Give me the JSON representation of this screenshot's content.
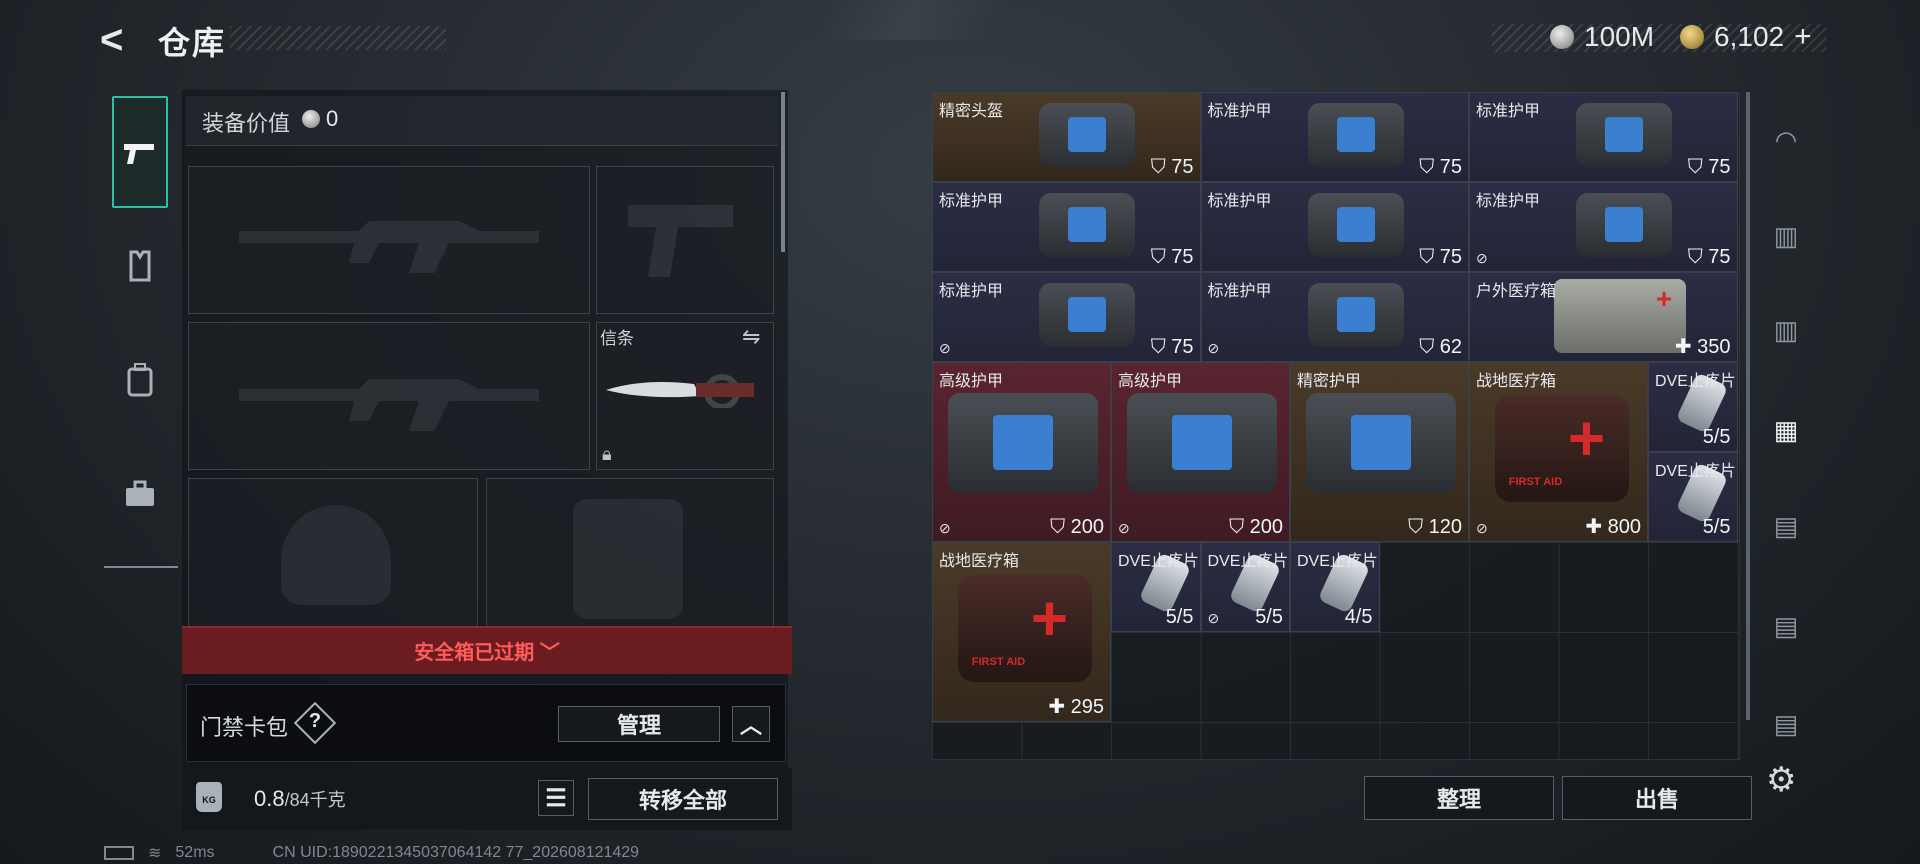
{
  "header": {
    "title": "仓库",
    "silver": "100M",
    "gold": "6,102",
    "add": "+"
  },
  "tabs": [
    "weapon-tab",
    "armor-tab",
    "backpack-tab",
    "case-tab"
  ],
  "equipment": {
    "label": "装备价值",
    "value": "0",
    "knife_label": "信条"
  },
  "safe_case": {
    "text": "安全箱已过期"
  },
  "keycard": {
    "label": "门禁卡包",
    "help": "?",
    "manage": "管理"
  },
  "weight": {
    "current": "0.8",
    "max": "/84千克",
    "transfer_all": "转移全部"
  },
  "status": {
    "ping": "52ms",
    "uid": "CN UID:1890221345037064142 77_202608121429"
  },
  "grid_items": [
    {
      "name": "精密头盔",
      "value": "75",
      "icon": "shield-icon"
    },
    {
      "name": "标准护甲",
      "value": "75",
      "icon": "shield-icon"
    },
    {
      "name": "标准护甲",
      "value": "75",
      "icon": "shield-icon"
    },
    {
      "name": "标准护甲",
      "value": "75",
      "icon": "shield-icon"
    },
    {
      "name": "标准护甲",
      "value": "75",
      "icon": "shield-icon"
    },
    {
      "name": "标准护甲",
      "value": "75",
      "icon": "shield-icon"
    },
    {
      "name": "标准护甲",
      "value": "75",
      "icon": "shield-icon"
    },
    {
      "name": "标准护甲",
      "value": "62",
      "icon": "shield-icon"
    },
    {
      "name": "户外医疗箱",
      "value": "350",
      "icon": "plus-icon"
    },
    {
      "name": "高级护甲",
      "value": "200",
      "icon": "shield-icon"
    },
    {
      "name": "高级护甲",
      "value": "200",
      "icon": "shield-icon"
    },
    {
      "name": "精密护甲",
      "value": "120",
      "icon": "shield-icon"
    },
    {
      "name": "战地医疗箱",
      "value": "800",
      "icon": "plus-icon"
    },
    {
      "name": "DVE止疼片",
      "value": "5/5"
    },
    {
      "name": "DVE止疼片",
      "value": "5/5"
    },
    {
      "name": "战地医疗箱",
      "value": "295",
      "icon": "plus-icon"
    },
    {
      "name": "DVE止疼片",
      "value": "5/5"
    },
    {
      "name": "DVE止疼片",
      "value": "5/5"
    },
    {
      "name": "DVE止疼片",
      "value": "4/5"
    }
  ],
  "kit_text": "FIRST AID",
  "actions": {
    "sort": "整理",
    "sell": "出售"
  },
  "side_tabs": [
    "helmet-tab",
    "armor-iii-tab",
    "armor-iii-b-tab",
    "case-iv-tab",
    "case-iv-b-tab",
    "case-v-tab",
    "case-iv-c-tab"
  ]
}
